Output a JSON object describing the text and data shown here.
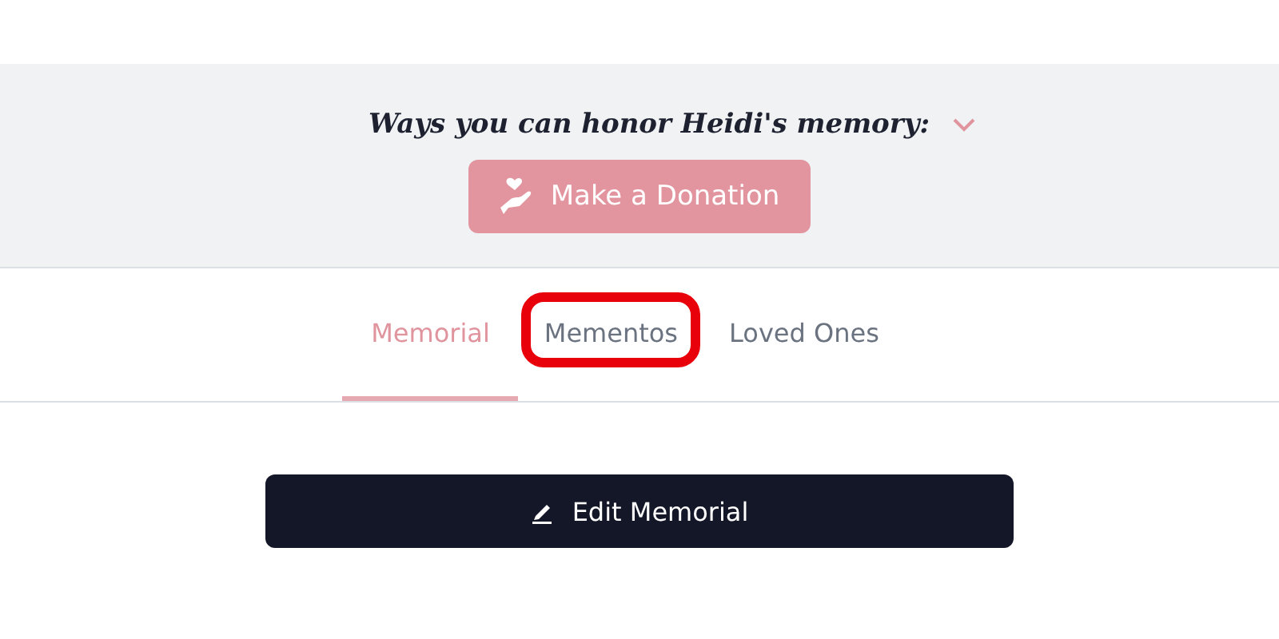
{
  "honor_banner": {
    "heading": "Ways you can honor Heidi's memory:",
    "expanded": false,
    "donate_button": "Make a Donation"
  },
  "tabs": [
    {
      "label": "Memorial",
      "selected": true,
      "highlighted": false
    },
    {
      "label": "Mementos",
      "selected": false,
      "highlighted": true
    },
    {
      "label": "Loved Ones",
      "selected": false,
      "highlighted": false
    }
  ],
  "edit_button": "Edit Memorial"
}
